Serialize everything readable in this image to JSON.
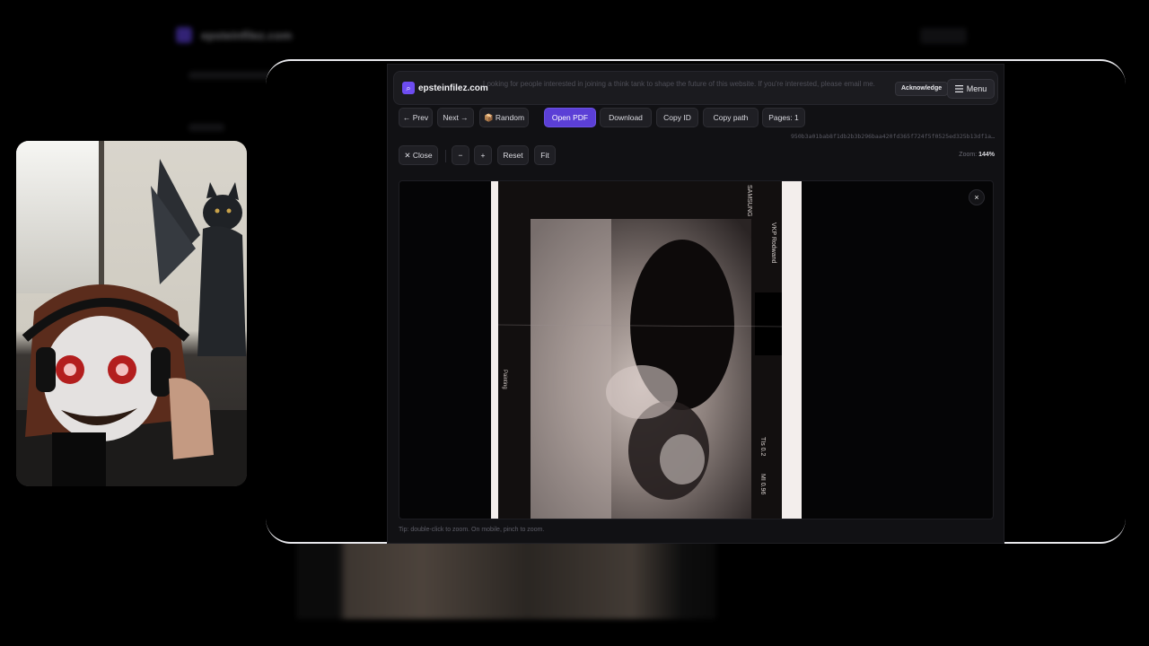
{
  "background_page": {
    "brand": "epsteinfilez.com"
  },
  "site": {
    "brand_name": "epsteinfilez.com",
    "notice": "Looking for people interested in joining a think tank to shape the future of this website. If you're interested, please email me.",
    "acknowledge_label": "Acknowledge",
    "menu_label": "Menu"
  },
  "toolbar": {
    "prev_label": "← Prev",
    "next_label": "Next →",
    "random_label": "📦 Random",
    "open_pdf_label": "Open PDF",
    "download_label": "Download",
    "copy_id_label": "Copy ID",
    "copy_path_label": "Copy path",
    "pages_label": "Pages: 1"
  },
  "file_hash": "950b3a01bab8f1db2b3b296baa420fd365f724f5f0525ed325b13df1a…",
  "zoom_bar": {
    "close_label": "✕ Close",
    "zoom_out_label": "−",
    "zoom_in_label": "+",
    "reset_label": "Reset",
    "fit_label": "Fit",
    "zoom_prefix": "Zoom: ",
    "zoom_value": "144%"
  },
  "viewer": {
    "close_glyph": "×",
    "scan_labels": {
      "top_right_a": "SAMSUNG",
      "top_right_b": "VKP Rodwand",
      "bottom_right_a": "TIs 0.2",
      "bottom_right_b": "MI 0.96",
      "left_side": "Painting"
    }
  },
  "tip": "Tip: double-click to zoom. On mobile, pinch to zoom.",
  "colors": {
    "accent": "#5b3fd6",
    "panel": "#111114",
    "frame": "#e8e8ec"
  }
}
